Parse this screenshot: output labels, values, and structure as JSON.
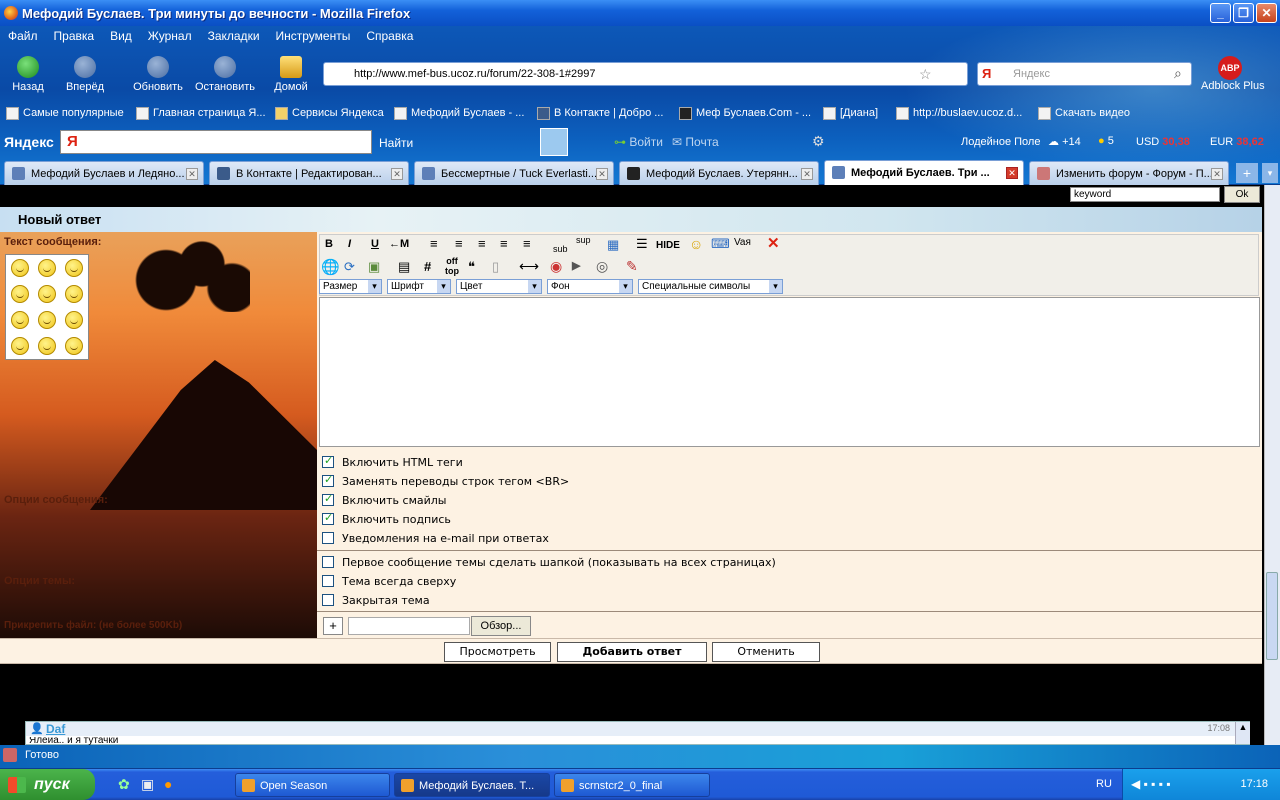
{
  "window": {
    "title": "Мефодий Буслаев. Три минуты до вечности - Mozilla Firefox"
  },
  "menu": [
    "Файл",
    "Правка",
    "Вид",
    "Журнал",
    "Закладки",
    "Инструменты",
    "Справка"
  ],
  "nav": {
    "back": "Назад",
    "forward": "Вперёд",
    "reload": "Обновить",
    "stop": "Остановить",
    "home": "Домой"
  },
  "url": "http://www.mef-bus.ucoz.ru/forum/22-308-1#2997",
  "search_placeholder": "Яндекс",
  "adblock": {
    "badge": "ABP",
    "label": "Adblock Plus"
  },
  "bookmarks": [
    "Самые популярные",
    "Главная страница Я...",
    "Сервисы Яндекса",
    "Мефодий Буслаев - ...",
    "В Контакте | Добро ...",
    "Меф Буслаев.Com - ...",
    "[Диана]",
    "http://buslaev.ucoz.d...",
    "Скачать видео"
  ],
  "yandex_bar": {
    "logo": "Яндекс",
    "find": "Найти",
    "login": "Войти",
    "mail": "Почта",
    "city": "Лодейное Поле",
    "temp": "+14",
    "score": "5",
    "usd_label": "USD",
    "usd": "30,38",
    "eur_label": "EUR",
    "eur": "38,62"
  },
  "tabs": [
    {
      "label": "Мефодий Буслаев и Ледяно...",
      "active": false
    },
    {
      "label": "В Контакте | Редактирован...",
      "active": false
    },
    {
      "label": "Бессмертные / Tuck Everlasti...",
      "active": false
    },
    {
      "label": "Мефодий Буслаев. Утерянн...",
      "active": false
    },
    {
      "label": "Мефодий Буслаев. Три ...",
      "active": true
    },
    {
      "label": "Изменить форум - Форум - П...",
      "active": false
    }
  ],
  "top_search": {
    "value": "keyword",
    "ok": "Ok"
  },
  "form": {
    "header": "Новый ответ",
    "message_label": "Текст сообщения:",
    "toolbar": {
      "bold": "B",
      "italic": "I",
      "underline": "U",
      "sub": "sub",
      "sup": "sup",
      "hide": "HIDE",
      "off": "off",
      "top": "top",
      "hash": "#",
      "m": "←M"
    },
    "selects": [
      "Размер",
      "Шрифт",
      "Цвет",
      "Фон",
      "Специальные символы"
    ],
    "message_options_label": "Опции сообщения:",
    "message_options": [
      {
        "label": "Включить HTML теги",
        "checked": true
      },
      {
        "label": "Заменять переводы строк тегом <BR>",
        "checked": true
      },
      {
        "label": "Включить смайлы",
        "checked": true
      },
      {
        "label": "Включить подпись",
        "checked": true
      },
      {
        "label": "Уведомления на e-mail при ответах",
        "checked": false
      }
    ],
    "topic_options_label": "Опции темы:",
    "topic_options": [
      {
        "label": "Первое сообщение темы сделать шапкой (показывать на всех страницах)",
        "checked": false
      },
      {
        "label": "Тема всегда сверху",
        "checked": false
      },
      {
        "label": "Закрытая тема",
        "checked": false
      }
    ],
    "attach_label": "Прикрепить файл: (не более 500Kb)",
    "add": "+",
    "browse": "Обзор...",
    "preview": "Просмотреть",
    "submit": "Добавить ответ",
    "cancel": "Отменить"
  },
  "comment": {
    "author": "Daf",
    "time": "17:08",
    "text": "Ялейа.. и я тутачки"
  },
  "status": "Готово",
  "taskbar": {
    "start": "пуск",
    "tasks": [
      "Open Season",
      "Мефодий Буслаев. Т...",
      "scrnstcr2_0_final"
    ],
    "lang": "RU",
    "clock": "17:18"
  }
}
